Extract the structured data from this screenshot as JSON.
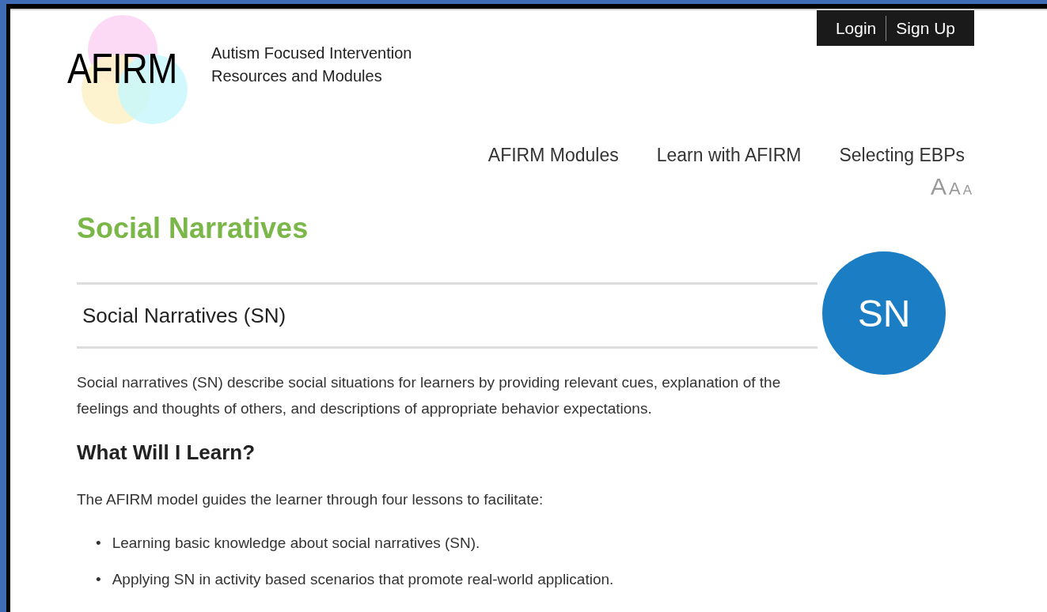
{
  "site": {
    "logo": "AFIRM",
    "tagline_lines": [
      "Autism Focused Intervention",
      "Resources and Modules"
    ]
  },
  "account": [
    "Login",
    "Sign Up"
  ],
  "nav": [
    "AFIRM Modules",
    "Learn with AFIRM",
    "Selecting EBPs"
  ],
  "text_size": [
    "A",
    "A",
    "A"
  ],
  "page_title": "Social Narratives",
  "module": {
    "title": "Social Narratives (SN)",
    "badge": "SN"
  },
  "intro": "Social narratives (SN) describe social situations for learners by providing relevant cues, explanation of the feelings and thoughts of others, and descriptions of appropriate behavior expectations.",
  "section": {
    "heading": "What Will I Learn?",
    "lead": "The AFIRM model guides the learner through four lessons to facilitate:",
    "items": [
      {
        "bullet": "•",
        "text": "Learning basic knowledge about social narratives (SN)."
      },
      {
        "bullet": "•",
        "text": "Applying SN in activity based scenarios that promote real-world application."
      }
    ]
  }
}
